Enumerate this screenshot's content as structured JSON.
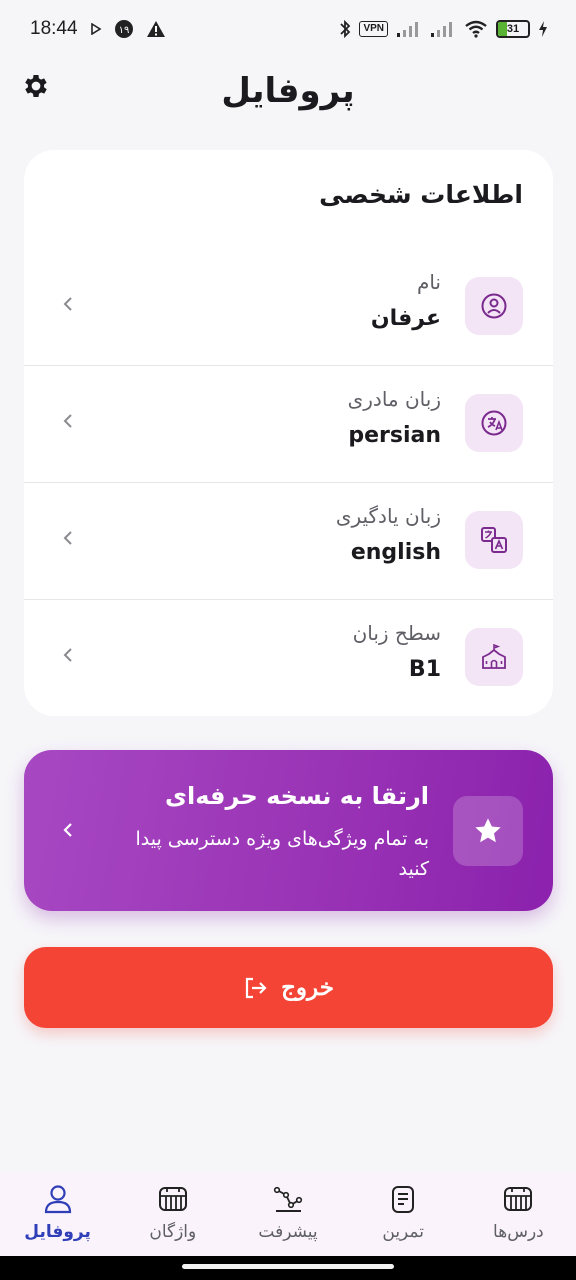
{
  "status_bar": {
    "time": "18:44",
    "notification_badge": "۱۹",
    "vpn_label": "VPN",
    "battery_level": "31"
  },
  "header": {
    "title": "پروفایل"
  },
  "personal_info": {
    "title": "اطلاعات شخصی",
    "rows": [
      {
        "label": "نام",
        "value": "عرفان",
        "icon": "user-circle-icon"
      },
      {
        "label": "زبان مادری",
        "value": "persian",
        "icon": "translate-circle-icon"
      },
      {
        "label": "زبان یادگیری",
        "value": "english",
        "icon": "language-translate-icon"
      },
      {
        "label": "سطح زبان",
        "value": "B1",
        "icon": "school-building-icon"
      }
    ]
  },
  "upgrade": {
    "title": "ارتقا به نسخه حرفه‌ای",
    "subtitle": "به تمام ویژگی‌های ویژه دسترسی پیدا کنید",
    "icon": "star-icon"
  },
  "logout": {
    "label": "خروج",
    "icon": "logout-icon"
  },
  "bottom_nav": {
    "items": [
      {
        "label": "درس‌ها",
        "icon": "lessons-icon",
        "active": false
      },
      {
        "label": "تمرین",
        "icon": "practice-icon",
        "active": false
      },
      {
        "label": "پیشرفت",
        "icon": "progress-icon",
        "active": false
      },
      {
        "label": "واژگان",
        "icon": "vocabulary-icon",
        "active": false
      },
      {
        "label": "پروفایل",
        "icon": "profile-icon",
        "active": true
      }
    ]
  },
  "colors": {
    "accent_purple": "#9a34b6",
    "icon_tile_bg": "#f3e4f6",
    "logout_red": "#f44436",
    "active_nav": "#2f3fb8"
  }
}
